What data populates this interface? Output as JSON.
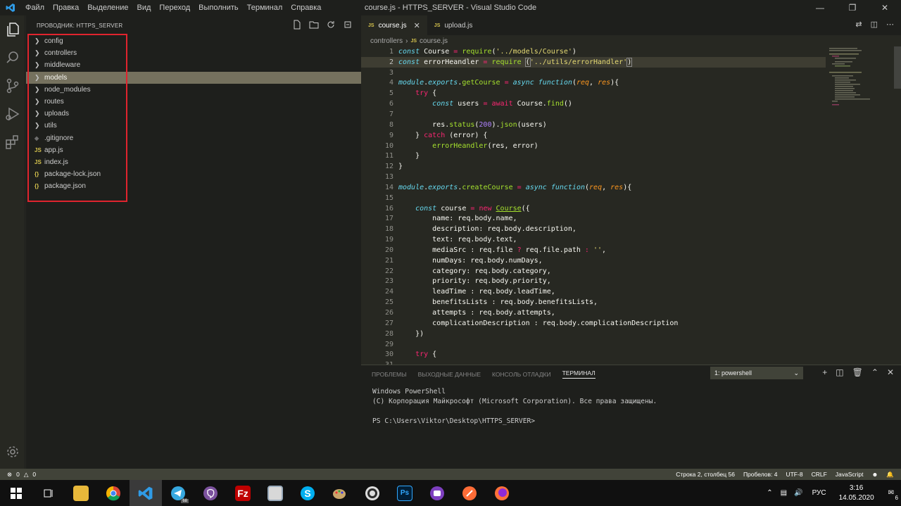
{
  "menu": [
    "Файл",
    "Правка",
    "Выделение",
    "Вид",
    "Переход",
    "Выполнить",
    "Терминал",
    "Справка"
  ],
  "window_title": "course.js - HTTPS_SERVER - Visual Studio Code",
  "explorer": {
    "header": "ПРОВОДНИК: HTTPS_SERVER",
    "items": [
      {
        "label": "config",
        "type": "folder"
      },
      {
        "label": "controllers",
        "type": "folder"
      },
      {
        "label": "middleware",
        "type": "folder"
      },
      {
        "label": "models",
        "type": "folder"
      },
      {
        "label": "node_modules",
        "type": "folder"
      },
      {
        "label": "routes",
        "type": "folder"
      },
      {
        "label": "uploads",
        "type": "folder"
      },
      {
        "label": "utils",
        "type": "folder"
      },
      {
        "label": ".gitignore",
        "type": "git"
      },
      {
        "label": "app.js",
        "type": "js"
      },
      {
        "label": "index.js",
        "type": "js"
      },
      {
        "label": "package-lock.json",
        "type": "json"
      },
      {
        "label": "package.json",
        "type": "json"
      }
    ],
    "selected": "models"
  },
  "tabs": [
    {
      "label": "course.js",
      "active": true
    },
    {
      "label": "upload.js",
      "active": false
    }
  ],
  "breadcrumb": {
    "folder": "controllers",
    "file": "course.js"
  },
  "code_lines": [
    "1",
    "2",
    "3",
    "4",
    "5",
    "6",
    "7",
    "8",
    "9",
    "10",
    "11",
    "12",
    "13",
    "14",
    "15",
    "16",
    "17",
    "18",
    "19",
    "20",
    "21",
    "22",
    "23",
    "24",
    "25",
    "26",
    "27",
    "28",
    "29",
    "30",
    "31"
  ],
  "panel": {
    "tabs": [
      "ПРОБЛЕМЫ",
      "ВЫХОДНЫЕ ДАННЫЕ",
      "КОНСОЛЬ ОТЛАДКИ",
      "ТЕРМИНАЛ"
    ],
    "active_tab": "ТЕРМИНАЛ",
    "terminal_select": "1: powershell",
    "terminal_lines": [
      "Windows PowerShell",
      "(C) Корпорация Майкрософт (Microsoft Corporation). Все права защищены.",
      "",
      "PS C:\\Users\\Viktor\\Desktop\\HTTPS_SERVER>"
    ]
  },
  "status": {
    "errors": "0",
    "warnings": "0",
    "position": "Строка 2, столбец 56",
    "spaces": "Пробелов: 4",
    "encoding": "UTF-8",
    "eol": "CRLF",
    "language": "JavaScript"
  },
  "taskbar": {
    "telegram_badge": "68",
    "lang": "РУС",
    "time": "3:16",
    "date": "14.05.2020",
    "notifications": "6"
  },
  "colors": {
    "accent": "#e0242e",
    "keyword": "#f92672",
    "string": "#e6db74",
    "function": "#a6e22e"
  }
}
